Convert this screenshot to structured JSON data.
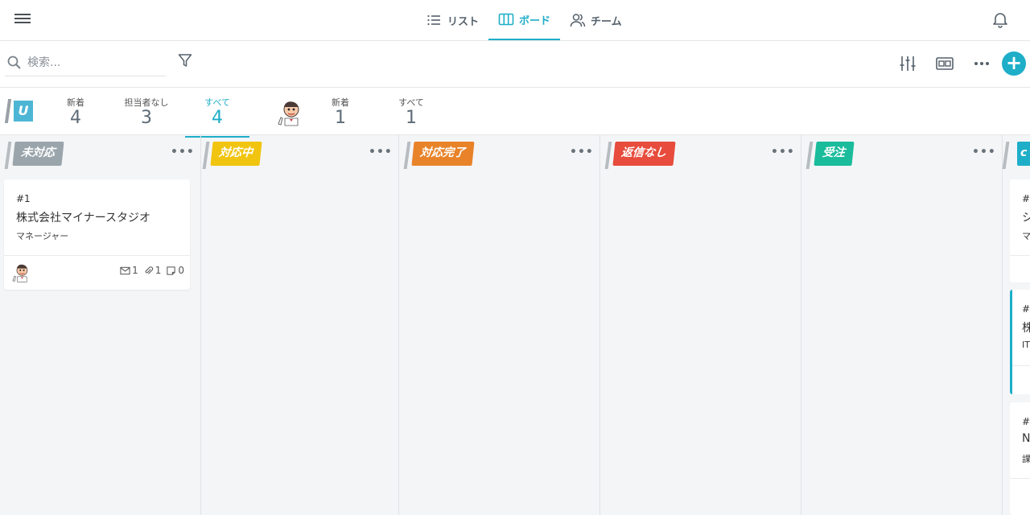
{
  "nav": {
    "tabs": [
      {
        "label": "リスト",
        "icon": "list-icon"
      },
      {
        "label": "ボード",
        "icon": "board-icon",
        "active": true
      },
      {
        "label": "チーム",
        "icon": "team-icon"
      }
    ]
  },
  "toolbar": {
    "search_placeholder": "検索...",
    "add_label": "+"
  },
  "counters": {
    "team_badge": "U",
    "team": [
      {
        "label": "新着",
        "value": "4"
      },
      {
        "label": "担当者なし",
        "value": "3"
      },
      {
        "label": "すべて",
        "value": "4",
        "active": true
      }
    ],
    "personal": [
      {
        "label": "新着",
        "value": "1"
      },
      {
        "label": "すべて",
        "value": "1"
      }
    ]
  },
  "columns": [
    {
      "label": "未対応",
      "color": "#9aa5ab"
    },
    {
      "label": "対応中",
      "color": "#f1c40f"
    },
    {
      "label": "対応完了",
      "color": "#e8832a"
    },
    {
      "label": "返信なし",
      "color": "#e74c3c"
    },
    {
      "label": "受注",
      "color": "#1abc9c"
    }
  ],
  "column_more": "•••",
  "cards": [
    {
      "id": "#1",
      "title": "株式会社マイナースタジオ",
      "role": "マネージャー",
      "mail_count": "1",
      "attach_count": "1",
      "note_count": "0"
    }
  ],
  "partial_column": {
    "tag": "c",
    "color": "#1eaec8",
    "cards": [
      {
        "line1": "#",
        "line2": "シ",
        "line3": "マ"
      },
      {
        "line1": "#",
        "line2": "株",
        "line3": "IT"
      },
      {
        "line1": "#",
        "line2": "N",
        "line3": "課"
      }
    ]
  }
}
